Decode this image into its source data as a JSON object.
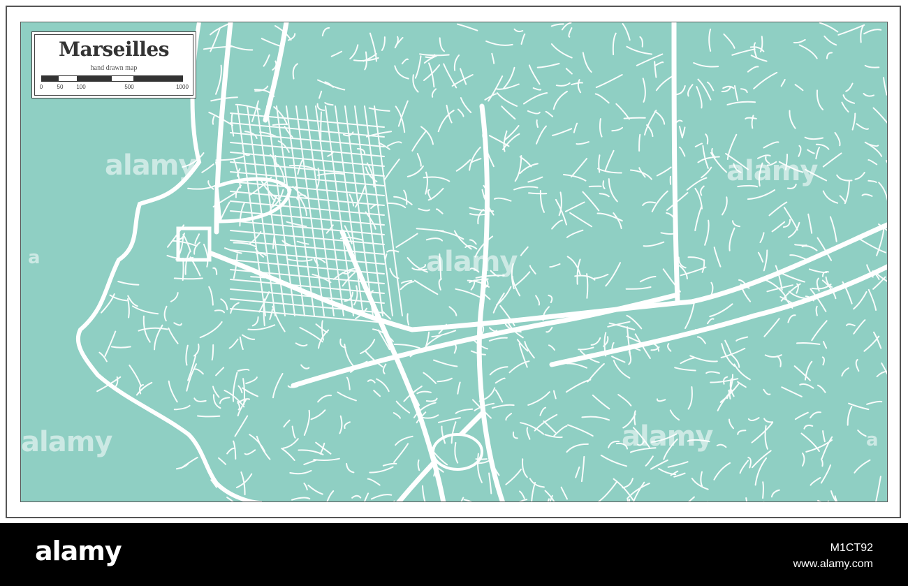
{
  "map": {
    "title": "Marseilles",
    "subtitle": "hand drawn map",
    "scale_labels": [
      "0",
      "50",
      "100",
      "500",
      "1000"
    ],
    "colors": {
      "land": "#8fcfc3",
      "water": "#8fcfc3",
      "roads": "#ffffff",
      "frame": "#555555"
    }
  },
  "watermarks": [
    "alamy",
    "alamy",
    "alamy",
    "alamy",
    "alamy",
    "a",
    "a"
  ],
  "footer": {
    "logo": "alamy",
    "image_id": "M1CT92",
    "url": "www.alamy.com"
  }
}
